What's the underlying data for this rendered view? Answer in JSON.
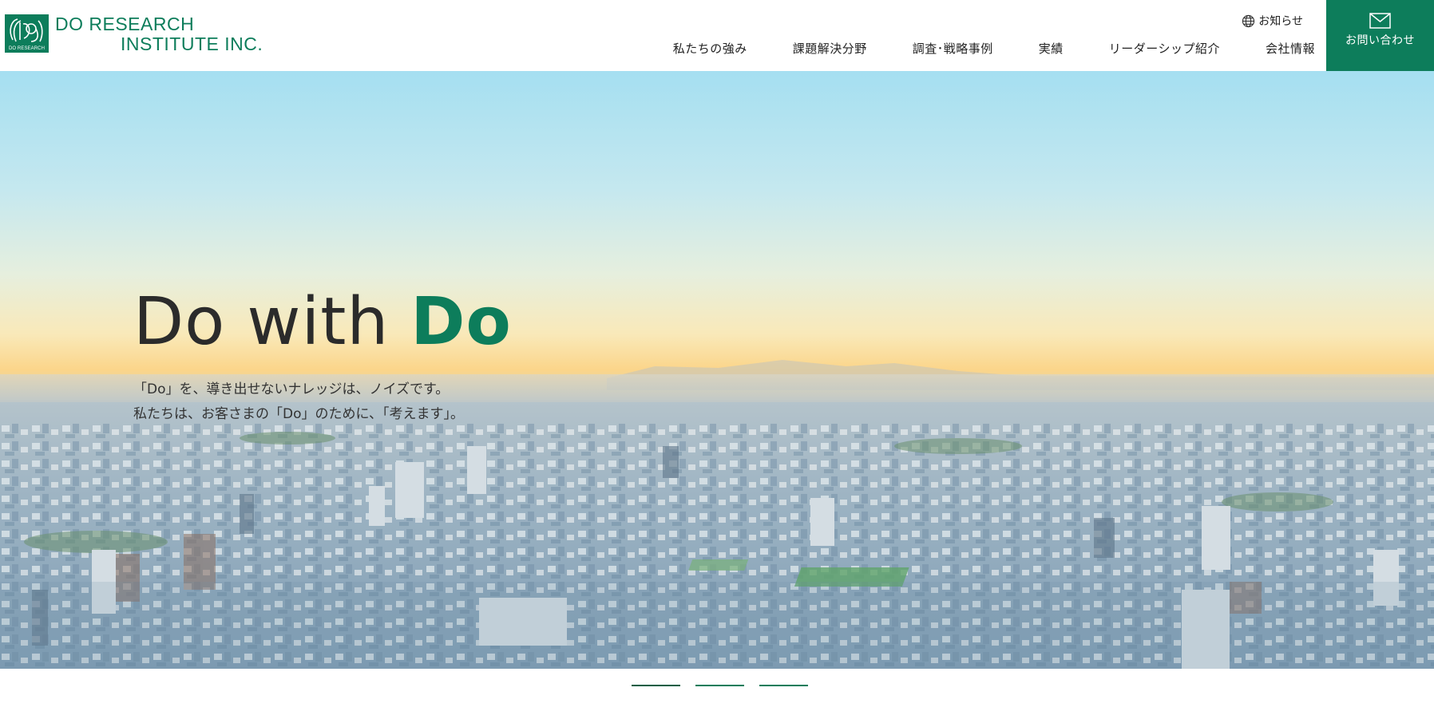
{
  "brand": {
    "line1": "DO RESEARCH",
    "line2": "INSTITUTE INC.",
    "mark_label": "DO RESEARCH",
    "color": "#0d7d5b"
  },
  "header": {
    "news_label": "お知らせ",
    "news_icon": "globe-icon",
    "contact_label": "お問い合わせ",
    "contact_icon": "mail-icon",
    "nav": [
      {
        "label": "私たちの強み"
      },
      {
        "label": "課題解決分野"
      },
      {
        "label": "調査･戦略事例"
      },
      {
        "label": "実績"
      },
      {
        "label": "リーダーシップ紹介"
      },
      {
        "label": "会社情報"
      }
    ]
  },
  "hero": {
    "title_main": "Do with ",
    "title_accent": "Do",
    "lead": [
      "「Do」を、導き出せないナレッジは、ノイズです。",
      "私たちは、お客さまの「Do」のために、「考えます」。"
    ],
    "background": "city-skyline-image"
  },
  "slider": {
    "count": 3,
    "active": 1
  }
}
